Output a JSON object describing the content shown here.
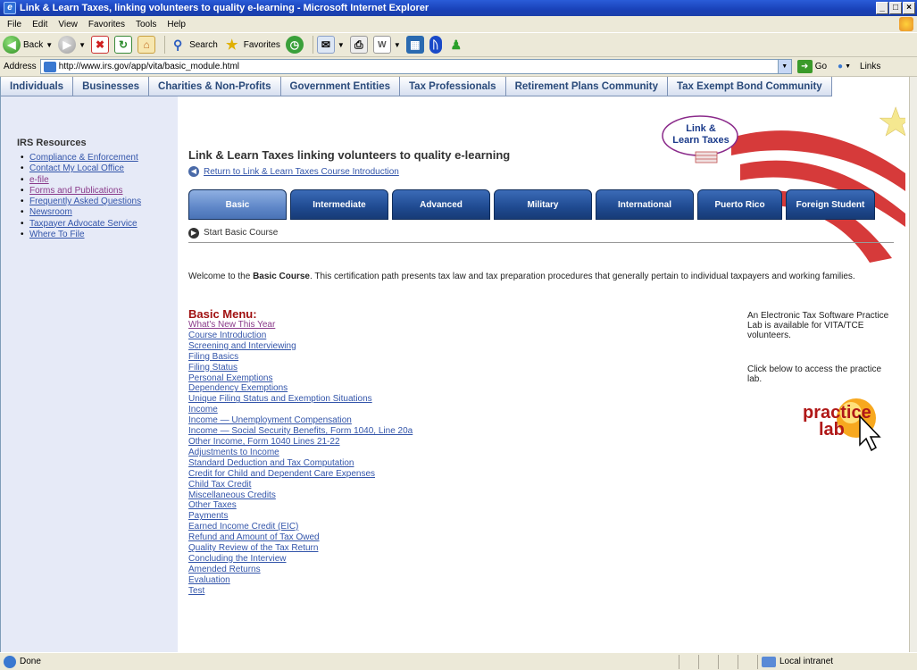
{
  "window": {
    "title": "Link & Learn Taxes, linking volunteers to quality e-learning - Microsoft Internet Explorer",
    "controls": [
      "_",
      "□",
      "×"
    ]
  },
  "menubar": {
    "items": [
      "File",
      "Edit",
      "View",
      "Favorites",
      "Tools",
      "Help"
    ]
  },
  "toolbar": {
    "back_label": "Back",
    "search_label": "Search",
    "favorites_label": "Favorites"
  },
  "addressbar": {
    "label": "Address",
    "url": "http://www.irs.gov/app/vita/basic_module.html",
    "go_label": "Go",
    "links_label": "Links"
  },
  "site_nav": {
    "tabs": [
      "Individuals",
      "Businesses",
      "Charities & Non-Profits",
      "Government Entities",
      "Tax Professionals",
      "Retirement Plans Community",
      "Tax Exempt Bond Community"
    ]
  },
  "sidebar": {
    "title": "IRS Resources",
    "items": [
      "Compliance & Enforcement",
      "Contact My Local Office",
      "e-file",
      "Forms and Publications",
      "Frequently Asked Questions",
      "Newsroom",
      "Taxpayer Advocate Service",
      "Where To File"
    ]
  },
  "main": {
    "heading": "Link & Learn Taxes linking volunteers to quality e-learning",
    "return_link": "Return to Link & Learn Taxes Course Introduction",
    "logo_line1": "Link &",
    "logo_line2": "Learn Taxes",
    "module_tabs": [
      "Basic",
      "Intermediate",
      "Advanced",
      "Military",
      "International",
      "Puerto Rico",
      "Foreign Student"
    ],
    "active_tab": "Basic",
    "start_link": "Start Basic Course",
    "welcome_pre": "Welcome to the ",
    "welcome_bold": "Basic Course",
    "welcome_post": ". This certification path presents tax law and tax preparation procedures that generally pertain to individual taxpayers and working families.",
    "menu_title": "Basic Menu:",
    "menu_items": [
      "What's New This Year",
      "Course Introduction",
      "Screening and Interviewing",
      "Filing Basics",
      "Filing Status",
      "Personal Exemptions",
      "Dependency Exemptions",
      "Unique Filing Status and Exemption Situations",
      "Income",
      "Income — Unemployment Compensation",
      "Income — Social Security Benefits, Form 1040, Line 20a",
      "Other Income, Form 1040 Lines 21-22",
      "Adjustments to Income",
      "Standard Deduction and Tax Computation",
      "Credit for Child and Dependent Care Expenses",
      "Child Tax Credit",
      "Miscellaneous Credits",
      "Other Taxes",
      "Payments",
      "Earned Income Credit (EIC)",
      "Refund and Amount of Tax Owed",
      "Quality Review of the Tax Return",
      "Concluding the Interview",
      "Amended Returns",
      "Evaluation",
      "Test"
    ],
    "side_note_1": "An Electronic Tax Software Practice Lab is available for VITA/TCE volunteers.",
    "side_note_2": "Click below to access the practice lab.",
    "practice_lab_line1": "practice",
    "practice_lab_line2": "lab"
  },
  "statusbar": {
    "status": "Done",
    "zone": "Local intranet"
  },
  "colors": {
    "title_blue": "#1941b8",
    "link_blue": "#3355aa",
    "menu_red": "#a01010",
    "tab_dark_blue": "#1f4a90",
    "sidebar_bg": "#e6eaf7"
  }
}
